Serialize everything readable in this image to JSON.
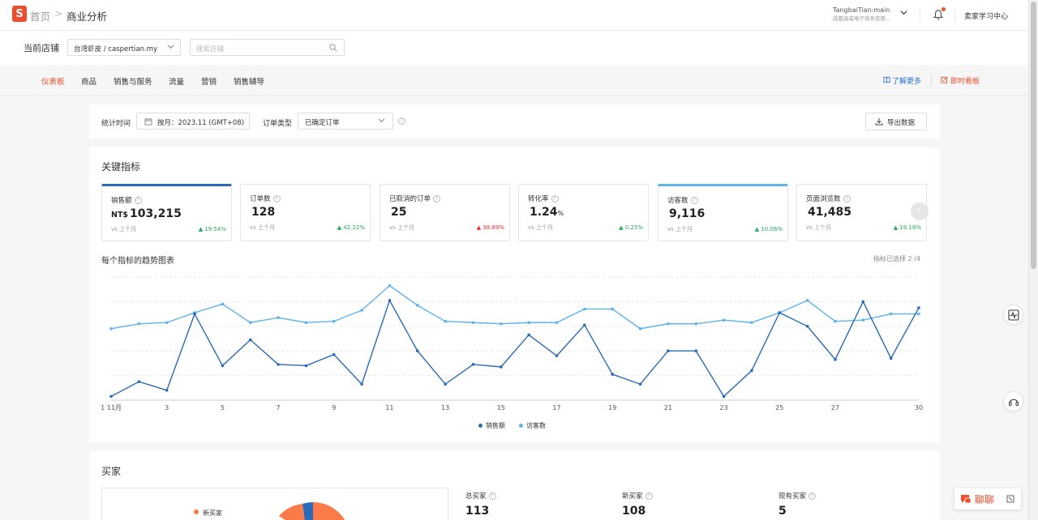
{
  "header": {
    "logo_letter": "S",
    "breadcrumb_home": "首页",
    "breadcrumb_sep": ">",
    "breadcrumb_current": "商业分析",
    "account_name": "TangbaiTian:main",
    "account_company": "成都高威电子商务有限...",
    "learning_center": "卖家学习中心"
  },
  "shop": {
    "label": "当前店铺",
    "selected": "台湾虾皮 / caspertian.my",
    "search_placeholder": "搜索店铺"
  },
  "nav": {
    "tabs": [
      {
        "label": "仪表板",
        "active": true
      },
      {
        "label": "商品",
        "active": false
      },
      {
        "label": "销售与服务",
        "active": false
      },
      {
        "label": "流量",
        "active": false
      },
      {
        "label": "营销",
        "active": false
      },
      {
        "label": "销售辅导",
        "active": false
      }
    ],
    "learn_more": "了解更多",
    "live_board": "即时看板"
  },
  "filters": {
    "time_label": "统计时间",
    "time_value": "按月：2023.11 (GMT+08)",
    "order_type_label": "订单类型",
    "order_type_value": "已确定订单",
    "export_label": "导出数据"
  },
  "key_metrics": {
    "title": "关键指标",
    "items": [
      {
        "label": "销售额",
        "prefix": "NT$",
        "value": "103,215",
        "unit": "",
        "vs": "vs 上个月",
        "change": "19.54%",
        "direction": "up",
        "color": "#26aa5a",
        "selected": "dark"
      },
      {
        "label": "订单数",
        "prefix": "",
        "value": "128",
        "unit": "",
        "vs": "vs 上个月",
        "change": "42.22%",
        "direction": "up",
        "color": "#26aa5a",
        "selected": ""
      },
      {
        "label": "已取消的订单",
        "prefix": "",
        "value": "25",
        "unit": "",
        "vs": "vs 上个月",
        "change": "38.89%",
        "direction": "up",
        "color": "#ee2c2c",
        "selected": ""
      },
      {
        "label": "转化率",
        "prefix": "",
        "value": "1.24",
        "unit": "%",
        "vs": "vs 上个月",
        "change": "0.25%",
        "direction": "up",
        "color": "#26aa5a",
        "selected": ""
      },
      {
        "label": "访客数",
        "prefix": "",
        "value": "9,116",
        "unit": "",
        "vs": "vs 上个月",
        "change": "10.06%",
        "direction": "up",
        "color": "#26aa5a",
        "selected": "light"
      },
      {
        "label": "页面浏览数",
        "prefix": "",
        "value": "41,485",
        "unit": "",
        "vs": "vs 上个月",
        "change": "19.18%",
        "direction": "up",
        "color": "#26aa5a",
        "selected": ""
      }
    ]
  },
  "trend": {
    "title": "每个指标的趋势图表",
    "selected_note": "指标已选择 2 /4"
  },
  "chart_data": {
    "type": "line",
    "x": [
      1,
      2,
      3,
      4,
      5,
      6,
      7,
      8,
      9,
      10,
      11,
      12,
      13,
      14,
      15,
      16,
      17,
      18,
      19,
      20,
      21,
      22,
      23,
      24,
      25,
      26,
      27,
      28,
      29,
      30
    ],
    "x_tick_labels": [
      "1 11月",
      "3",
      "5",
      "7",
      "9",
      "11",
      "13",
      "15",
      "17",
      "19",
      "21",
      "23",
      "25",
      "27",
      "30"
    ],
    "x_tick_values": [
      1,
      3,
      5,
      7,
      9,
      11,
      13,
      15,
      17,
      19,
      21,
      23,
      25,
      27,
      30
    ],
    "ylim": [
      0,
      100
    ],
    "grid": true,
    "legend_position": "bottom-center",
    "series": [
      {
        "name": "销售额",
        "color": "#2a6ab8",
        "values": [
          3,
          15,
          8,
          70,
          28,
          49,
          29,
          28,
          37,
          13,
          81,
          40,
          13,
          29,
          27,
          53,
          36,
          61,
          21,
          13,
          40,
          40,
          3,
          24,
          71,
          60,
          33,
          80,
          34,
          75
        ]
      },
      {
        "name": "访客数",
        "color": "#5db3ea",
        "values": [
          58,
          62,
          63,
          71,
          78,
          63,
          67,
          63,
          64,
          73,
          93,
          77,
          64,
          63,
          62,
          63,
          63,
          74,
          74,
          58,
          62,
          62,
          65,
          63,
          71,
          81,
          64,
          65,
          70,
          70
        ]
      }
    ]
  },
  "buyers": {
    "title": "买家",
    "pie_legend": "新买家",
    "stats": [
      {
        "label": "总买家",
        "value": "113"
      },
      {
        "label": "新买家",
        "value": "108"
      },
      {
        "label": "现有买家",
        "value": "5"
      }
    ]
  },
  "chat": {
    "label": "聊聊"
  }
}
